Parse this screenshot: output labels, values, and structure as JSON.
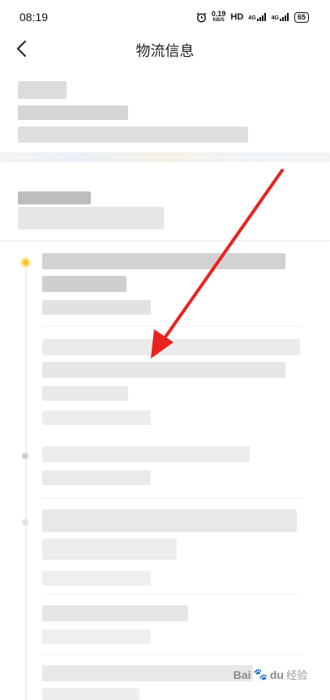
{
  "status_bar": {
    "time": "08:19",
    "speed_value": "0.19",
    "speed_unit": "KB/S",
    "hd_label": "HD",
    "signal1": "4G",
    "signal2": "4G",
    "battery": "65",
    "alarm_icon": "alarm-clock-icon"
  },
  "nav": {
    "title": "物流信息",
    "back_icon": "chevron-left-icon"
  },
  "watermark": {
    "brand": "Bai",
    "brand2": "du",
    "suffix": "经验"
  },
  "colors": {
    "active_dot": "#f5c518",
    "inactive_dot": "#cfcfcf",
    "arrow": "#e8231f",
    "blur_dark": "#cfcfcf",
    "blur_mid": "#e3e3e3",
    "blur_light": "#efefef"
  }
}
